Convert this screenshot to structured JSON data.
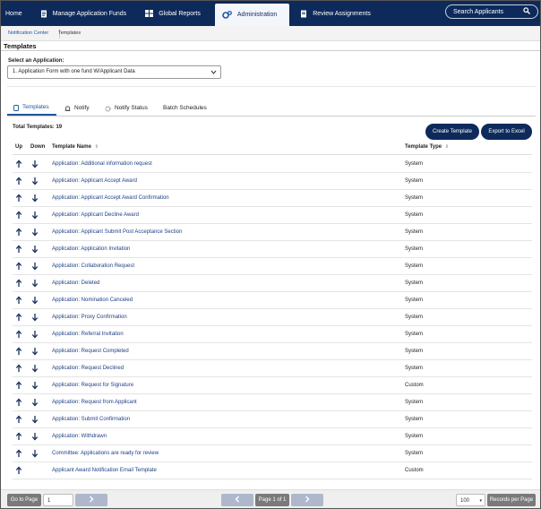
{
  "nav": {
    "home": "Home",
    "manage_funds": "Manage Application Funds",
    "global_reports": "Global Reports",
    "administration": "Administration",
    "review_assignments": "Review Assignments",
    "search_placeholder": "Search Applicants"
  },
  "breadcrumb": {
    "parent": "Notification Center",
    "current": "Templates"
  },
  "page": {
    "title": "Templates",
    "select_label": "Select an Application:",
    "select_value": "1. Application Form with one fund W/Applicant Data"
  },
  "tabs": [
    {
      "label": "Templates",
      "icon": "page-icon"
    },
    {
      "label": "Notify",
      "icon": "bell-icon"
    },
    {
      "label": "Notify Status",
      "icon": "spinner-icon"
    },
    {
      "label": "Batch Schedules",
      "icon": ""
    }
  ],
  "summary": {
    "total_label": "Total Templates: 19"
  },
  "actions": {
    "create": "Create Template",
    "export": "Export to Excel"
  },
  "table": {
    "headers": {
      "up": "Up",
      "down": "Down",
      "name": "Template Name",
      "type": "Template Type"
    },
    "rows": [
      {
        "name": "Application: Additional information request",
        "type": "System",
        "up": true,
        "down": true
      },
      {
        "name": "Application: Applicant Accept Award",
        "type": "System",
        "up": true,
        "down": true
      },
      {
        "name": "Application: Applicant Accept Award Confirmation",
        "type": "System",
        "up": true,
        "down": true
      },
      {
        "name": "Application: Applicant Decline Award",
        "type": "System",
        "up": true,
        "down": true
      },
      {
        "name": "Application: Applicant Submit Post Acceptance Section",
        "type": "System",
        "up": true,
        "down": true
      },
      {
        "name": "Application: Application Invitation",
        "type": "System",
        "up": true,
        "down": true
      },
      {
        "name": "Application: Collaboration Request",
        "type": "System",
        "up": true,
        "down": true
      },
      {
        "name": "Application: Deleted",
        "type": "System",
        "up": true,
        "down": true
      },
      {
        "name": "Application: Nomination Canceled",
        "type": "System",
        "up": true,
        "down": true
      },
      {
        "name": "Application: Proxy Confirmation",
        "type": "System",
        "up": true,
        "down": true
      },
      {
        "name": "Application: Referral Invitation",
        "type": "System",
        "up": true,
        "down": true
      },
      {
        "name": "Application: Request Completed",
        "type": "System",
        "up": true,
        "down": true
      },
      {
        "name": "Application: Request Declined",
        "type": "System",
        "up": true,
        "down": true
      },
      {
        "name": "Application: Request for Signature",
        "type": "Custom",
        "up": true,
        "down": true
      },
      {
        "name": "Application: Request from Applicant",
        "type": "System",
        "up": true,
        "down": true
      },
      {
        "name": "Application: Submit Confirmation",
        "type": "System",
        "up": true,
        "down": true
      },
      {
        "name": "Application: Withdrawn",
        "type": "System",
        "up": true,
        "down": true
      },
      {
        "name": "Committee: Applications are ready for review",
        "type": "System",
        "up": true,
        "down": true
      },
      {
        "name": "Applicant Award Notification Email Template",
        "type": "Custom",
        "up": true,
        "down": false
      }
    ]
  },
  "footer": {
    "go_to_page": "Go to Page",
    "page_input": "1",
    "page_indicator": "Page 1 of 1",
    "per_page_value": "100",
    "records_per_page": "Records per Page"
  }
}
